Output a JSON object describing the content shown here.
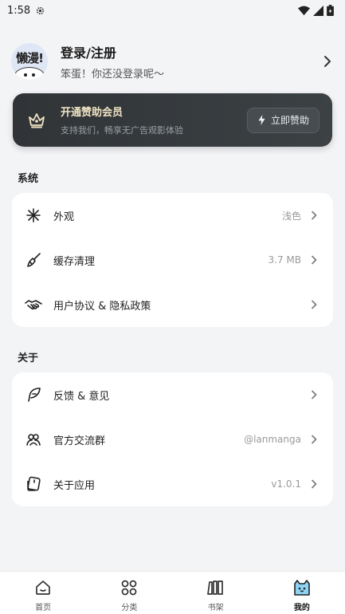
{
  "status_bar": {
    "time": "1:58"
  },
  "profile": {
    "avatar_text": "懒漫!",
    "title": "登录/注册",
    "subtitle": "笨蛋！你还没登录呢～"
  },
  "vip": {
    "title": "开通赞助会员",
    "subtitle": "支持我们，畅享无广告观影体验",
    "button_label": "立即赞助"
  },
  "sections": {
    "system": {
      "title": "系统",
      "items": [
        {
          "label": "外观",
          "value": "浅色",
          "icon": "appearance-icon"
        },
        {
          "label": "缓存清理",
          "value": "3.7 MB",
          "icon": "broom-icon"
        },
        {
          "label": "用户协议 & 隐私政策",
          "value": "",
          "icon": "handshake-icon"
        }
      ]
    },
    "about": {
      "title": "关于",
      "items": [
        {
          "label": "反馈 & 意见",
          "value": "",
          "icon": "feather-icon"
        },
        {
          "label": "官方交流群",
          "value": "@lanmanga",
          "icon": "group-icon"
        },
        {
          "label": "关于应用",
          "value": "v1.0.1",
          "icon": "app-info-icon"
        }
      ]
    }
  },
  "tabbar": {
    "items": [
      {
        "label": "首页",
        "icon": "home-icon",
        "active": false
      },
      {
        "label": "分类",
        "icon": "category-icon",
        "active": false
      },
      {
        "label": "书架",
        "icon": "bookshelf-icon",
        "active": false
      },
      {
        "label": "我的",
        "icon": "cat-profile-icon",
        "active": true
      }
    ]
  },
  "colors": {
    "background": "#f3f4f6",
    "vip_card": "#333739",
    "vip_title": "#f1e4c4",
    "active_tab_icon": "#8fd3f4"
  }
}
